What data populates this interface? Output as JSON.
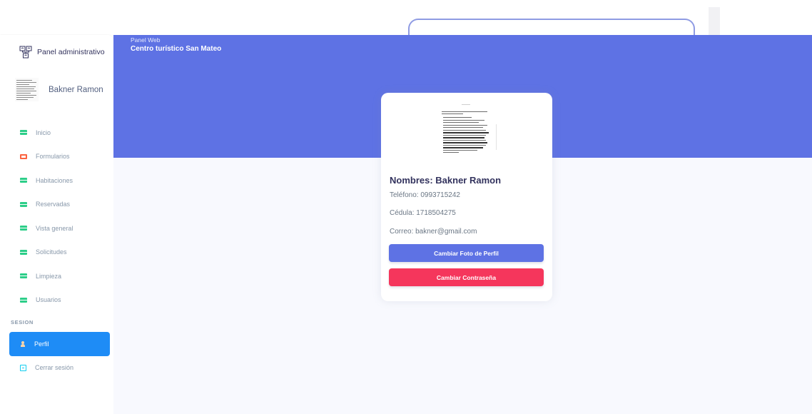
{
  "sidebar": {
    "brand": {
      "title": "Panel administrativo",
      "icon": "sitemap-icon"
    },
    "user": {
      "name": "Bakner Ramon"
    },
    "items": [
      {
        "label": "Inicio",
        "icon": "tv-icon",
        "color": "#2dce89"
      },
      {
        "label": "Formularios",
        "icon": "calendar-icon",
        "color": "#fb6340"
      },
      {
        "label": "Habitaciones",
        "icon": "tv-icon",
        "color": "#2dce89"
      },
      {
        "label": "Reservadas",
        "icon": "tv-icon",
        "color": "#2dce89"
      },
      {
        "label": "Vista general",
        "icon": "tv-icon",
        "color": "#2dce89"
      },
      {
        "label": "Solicitudes",
        "icon": "tv-icon",
        "color": "#2dce89"
      },
      {
        "label": "Limpieza",
        "icon": "tv-icon",
        "color": "#2dce89"
      },
      {
        "label": "Usuarios",
        "icon": "tv-icon",
        "color": "#2dce89"
      }
    ],
    "section": "SESION",
    "session_items": [
      {
        "label": "Perfil",
        "icon": "user-icon",
        "active": true
      },
      {
        "label": "Cerrar sesión",
        "icon": "logout-icon",
        "color": "#11cdef"
      }
    ]
  },
  "header": {
    "subtitle": "Panel Web",
    "title": "Centro turístico San Mateo"
  },
  "profile": {
    "name": "Nombres: Bakner Ramon",
    "phone": "Teléfono: 0993715242",
    "id_number": "Cédula: 1718504275",
    "email": "Correo: bakner@gmail.com",
    "change_photo_label": "Cambiar Foto de Perfil",
    "change_password_label": "Cambiar Contraseña"
  },
  "colors": {
    "primary": "#5e72e4",
    "danger": "#f5365c",
    "active_nav": "#1e8cf6"
  }
}
